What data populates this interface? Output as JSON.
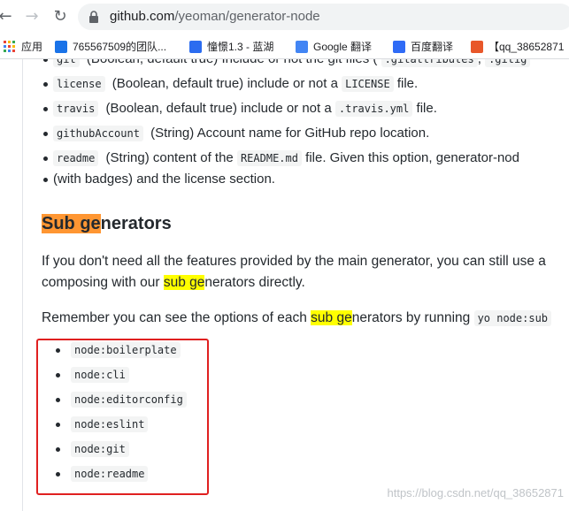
{
  "browser": {
    "url_host": "github.com",
    "url_path": "/yeoman/generator-node"
  },
  "bookmarks": [
    {
      "label": "应用",
      "color": "#ea4335"
    },
    {
      "label": "765567509的团队...",
      "color": "#1a73e8"
    },
    {
      "label": "憧憬1.3 - 蓝湖",
      "color": "#2b6cf0"
    },
    {
      "label": "Google 翻译",
      "color": "#4285f4"
    },
    {
      "label": "百度翻译",
      "color": "#2f6bf6"
    },
    {
      "label": "【qq_38652871",
      "color": "#e8572a"
    }
  ],
  "options": [
    {
      "code": "git",
      "desc": "(Boolean, default true) Include or not the git files (",
      "code2": ".gitattributes",
      "desc2": ",",
      "code3": ".gitig"
    },
    {
      "code": "license",
      "desc": "(Boolean, default true) include or not a",
      "code2": "LICENSE",
      "desc2": "file."
    },
    {
      "code": "travis",
      "desc": "(Boolean, default true) include or not a",
      "code2": ".travis.yml",
      "desc2": "file."
    },
    {
      "code": "githubAccount",
      "desc": "(String) Account name for GitHub repo location."
    },
    {
      "code": "readme",
      "desc": "(String) content of the",
      "code2": "README.md",
      "desc2": "file. Given this option, generator-nod"
    }
  ],
  "readme_continuation": "(with badges) and the license section.",
  "heading": {
    "hl": "Sub ge",
    "rest": "nerators"
  },
  "para1": {
    "line1": "If you don't need all the features provided by the main generator, you can still use a",
    "line2_pre": "composing with our ",
    "line2_hl": "sub ge",
    "line2_post": "nerators directly."
  },
  "para2": {
    "pre": "Remember you can see the options of each ",
    "hl": "sub ge",
    "post": "nerators by running ",
    "code": "yo node:sub"
  },
  "subgenerators": [
    "node:boilerplate",
    "node:cli",
    "node:editorconfig",
    "node:eslint",
    "node:git",
    "node:readme"
  ],
  "watermark": "https://blog.csdn.net/qq_38652871",
  "colors": {
    "highlight_orange": "#ff9632",
    "highlight_yellow": "#ffff00",
    "annotation_red": "#e02020"
  }
}
